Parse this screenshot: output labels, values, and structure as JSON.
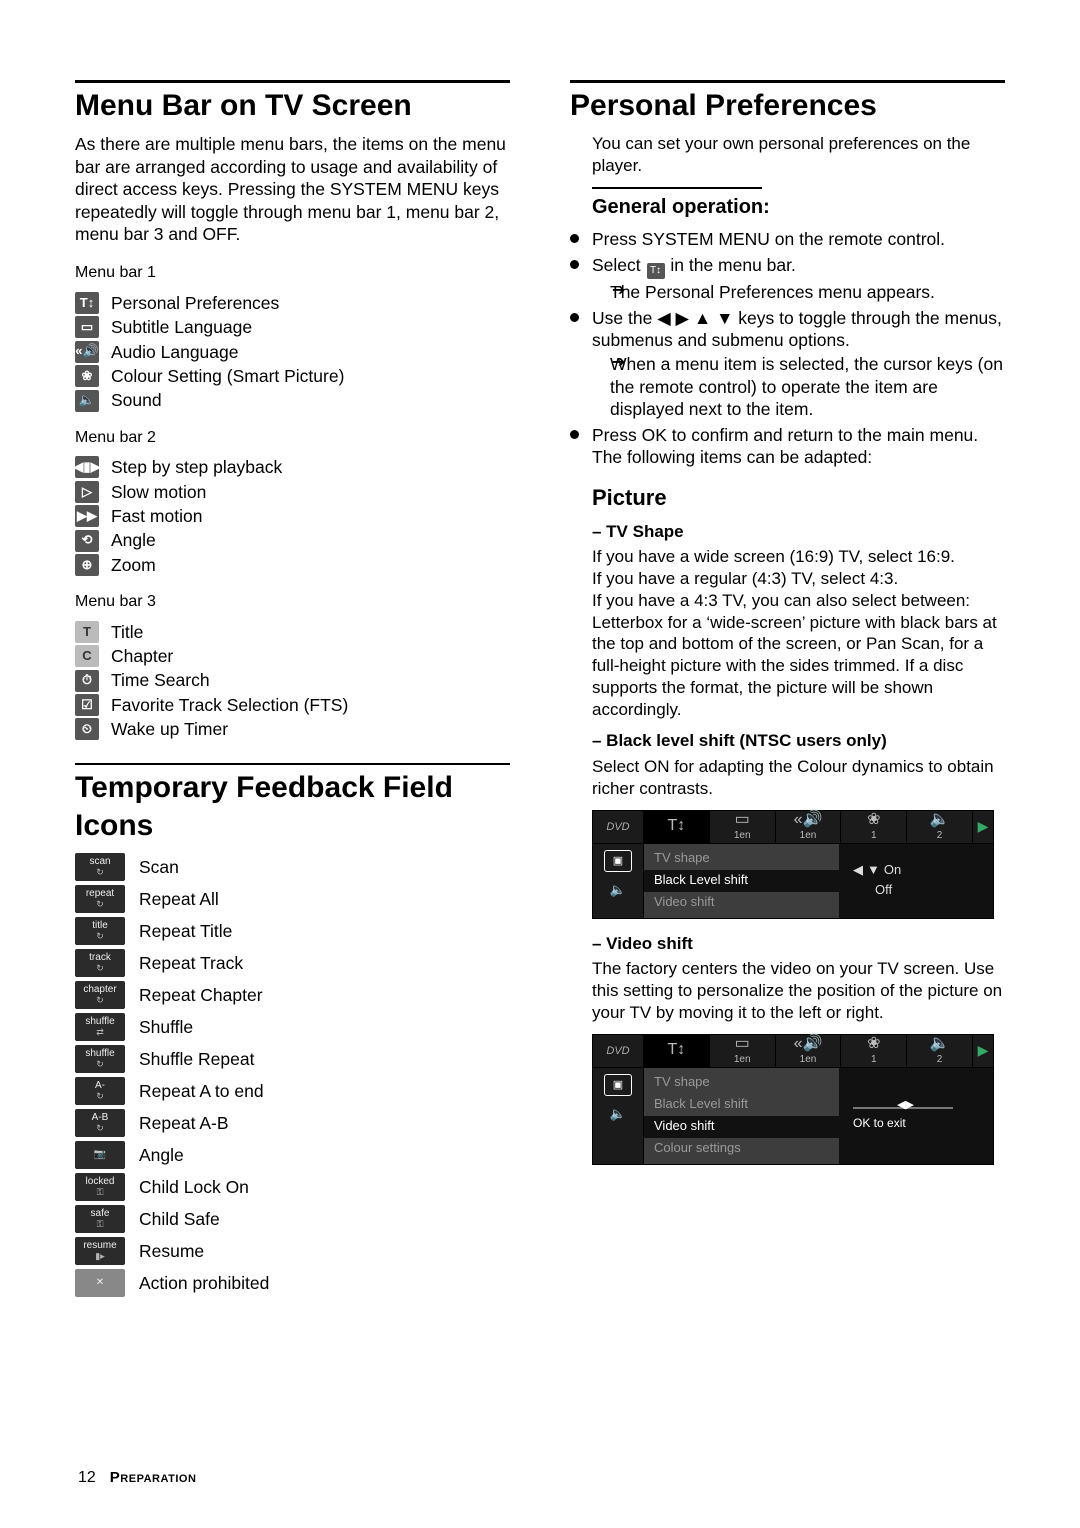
{
  "page": {
    "number": "12",
    "section": "Preparation"
  },
  "left": {
    "h1": "Menu Bar on TV Screen",
    "intro": "As there are multiple menu bars, the items on the menu bar are arranged according to usage and availability of direct access keys. Pressing the SYSTEM MENU keys repeatedly will toggle through menu bar 1, menu bar 2, menu bar 3 and OFF.",
    "mb1_title": "Menu bar 1",
    "mb1": [
      {
        "glyph": "T↕",
        "label": "Personal Preferences"
      },
      {
        "glyph": "▭",
        "label": "Subtitle Language"
      },
      {
        "glyph": "«🔊",
        "label": "Audio Language"
      },
      {
        "glyph": "❀",
        "label": "Colour Setting (Smart Picture)"
      },
      {
        "glyph": "🔈",
        "label": "Sound"
      }
    ],
    "mb2_title": "Menu bar 2",
    "mb2": [
      {
        "glyph": "◀▮▶",
        "label": "Step by step playback"
      },
      {
        "glyph": "▷",
        "label": "Slow motion"
      },
      {
        "glyph": "▶▶",
        "label": "Fast motion"
      },
      {
        "glyph": "⟲",
        "label": "Angle"
      },
      {
        "glyph": "⊕",
        "label": "Zoom"
      }
    ],
    "mb3_title": "Menu bar 3",
    "mb3": [
      {
        "glyph": "T",
        "label": "Title"
      },
      {
        "glyph": "C",
        "label": "Chapter"
      },
      {
        "glyph": "⏱",
        "label": "Time Search"
      },
      {
        "glyph": "☑",
        "label": "Favorite Track Selection (FTS)"
      },
      {
        "glyph": "⏲",
        "label": "Wake up Timer"
      }
    ],
    "h1b": "Temporary Feedback Field Icons",
    "fb": [
      {
        "tag": "scan",
        "label": "Scan"
      },
      {
        "tag": "repeat",
        "label": "Repeat All"
      },
      {
        "tag": "title",
        "label": "Repeat Title"
      },
      {
        "tag": "track",
        "label": "Repeat Track"
      },
      {
        "tag": "chapter",
        "label": "Repeat Chapter"
      },
      {
        "tag": "shuffle",
        "label": "Shuffle"
      },
      {
        "tag": "shuffle",
        "label": "Shuffle Repeat"
      },
      {
        "tag": "A-",
        "label": "Repeat A to end"
      },
      {
        "tag": "A-B",
        "label": "Repeat A-B"
      },
      {
        "tag": "",
        "label": "Angle"
      },
      {
        "tag": "locked",
        "label": "Child Lock On"
      },
      {
        "tag": "safe",
        "label": "Child Safe"
      },
      {
        "tag": "resume",
        "label": "Resume"
      },
      {
        "tag": "",
        "label": "Action prohibited"
      }
    ]
  },
  "right": {
    "h1": "Personal Preferences",
    "intro": "You can set your own personal preferences on the player.",
    "gen_title": "General operation:",
    "bul1": "Press SYSTEM MENU on the remote control.",
    "bul2a": "Select ",
    "bul2b": " in the menu bar.",
    "bul2_arrow": "The Personal Preferences menu appears.",
    "bul3_pre": "Use the ",
    "bul3_post": " keys to toggle through the menus, submenus and submenu options.",
    "bul3_arrow": "When a menu item is selected, the cursor keys (on the remote control) to operate the item are displayed next to the item.",
    "bul4a": "Press OK to confirm and return to the main menu.",
    "bul4b": "The following items can be adapted:",
    "picture": "Picture",
    "tvshape_t": "– TV Shape",
    "tvshape_b": "If you have a wide screen (16:9) TV, select 16:9.\nIf you have a regular (4:3) TV, select 4:3.\nIf you have a 4:3 TV, you can also select between: Letterbox for a ‘wide-screen’ picture with black bars at the top and bottom of the screen, or Pan Scan, for a full-height picture with the sides trimmed. If a disc supports the format, the picture will be shown accordingly.",
    "black_t": "– Black level shift (NTSC users only)",
    "black_b": "Select ON for adapting the Colour dynamics to obtain richer contrasts.",
    "video_t": "– Video shift",
    "video_b": "The factory centers the video on your TV screen. Use this setting to personalize the position of the picture on your TV by moving it to the left or right.",
    "osd1": {
      "top": {
        "c1": "1en",
        "c2": "1en",
        "c3": "1",
        "c4": "2"
      },
      "menu": [
        "TV shape",
        "Black Level shift",
        "Video shift"
      ],
      "activeIndex": 1,
      "opts": {
        "on": "On",
        "off": "Off"
      }
    },
    "osd2": {
      "top": {
        "c1": "1en",
        "c2": "1en",
        "c3": "1",
        "c4": "2"
      },
      "menu": [
        "TV shape",
        "Black Level shift",
        "Video shift",
        "Colour settings"
      ],
      "activeIndex": 2,
      "ok": "OK to exit"
    },
    "arrows": {
      "left": "◀",
      "right": "▶",
      "up": "▲",
      "down": "▼"
    }
  }
}
